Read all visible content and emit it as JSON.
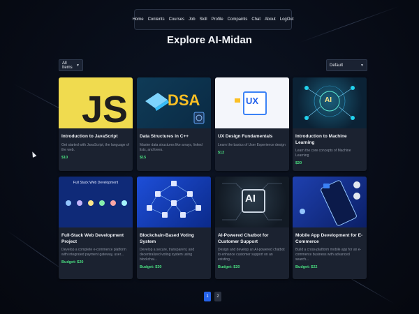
{
  "nav": {
    "items": [
      "Home",
      "Contents",
      "Courses",
      "Job",
      "Skill",
      "Profile",
      "Compaints",
      "Chat",
      "About",
      "LogOut"
    ]
  },
  "page_title": "Explore AI-Midan",
  "filters": {
    "category_selected": "All Items",
    "sort_selected": "Default"
  },
  "cards": [
    {
      "title": "Introduction to JavaScript",
      "desc": "Get started with JavaScript, the language of the web.",
      "price": "$10",
      "image_text": "JS"
    },
    {
      "title": "Data Structures in C++",
      "desc": "Master data structures like arrays, linked lists, and trees.",
      "price": "$15",
      "image_text": "DSA"
    },
    {
      "title": "UX Design Fundamentals",
      "desc": "Learn the basics of User Experience design",
      "price": "$12",
      "image_text": "UX"
    },
    {
      "title": "Introduction to Machine Learning",
      "desc": "Learn the core concepts of Machine Learning",
      "price": "$20",
      "image_text": "AI"
    },
    {
      "title": "Full-Stack Web Development Project",
      "desc": "Develop a complete e-commerce platform with integrated payment gateway, user...",
      "price": "Budget: $20",
      "image_text": "Full Stack Web Development"
    },
    {
      "title": "Blockchain-Based Voting System",
      "desc": "Develop a secure, transparent, and decentralized voting system using blockchai...",
      "price": "Budget: $30",
      "image_text": ""
    },
    {
      "title": "AI-Powered Chatbot for Customer Support",
      "desc": "Design and develop an AI-powered chatbot to enhance customer support on an existing...",
      "price": "Budget: $20",
      "image_text": "AI"
    },
    {
      "title": "Mobile App Development for E-Commerce",
      "desc": "Build a cross-platform mobile app for an e-commerce business with advanced search...",
      "price": "Budget: $22",
      "image_text": ""
    }
  ],
  "pagination": [
    "1",
    "2"
  ],
  "colors": {
    "accent_blue": "#2563eb",
    "price_green": "#4ade80",
    "js_yellow": "#f0db4f",
    "card_bg": "#1b2230"
  }
}
